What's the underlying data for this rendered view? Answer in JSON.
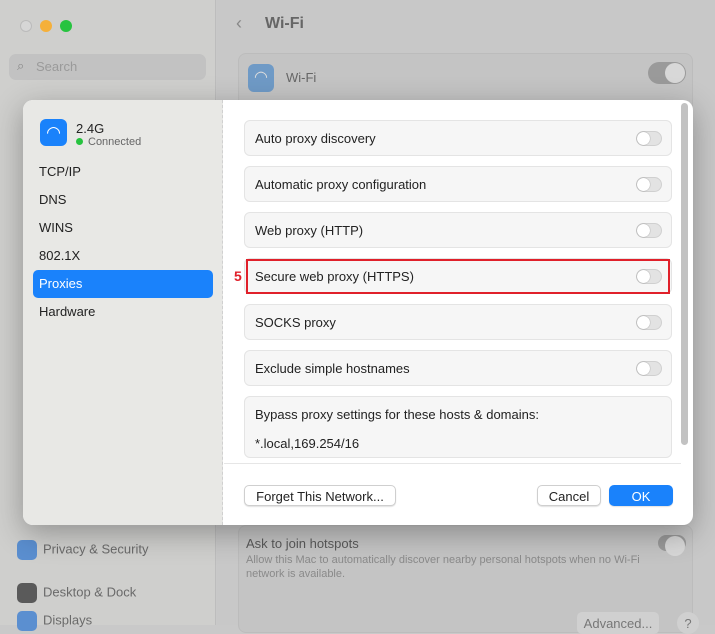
{
  "background": {
    "search_placeholder": "Search",
    "title": "Wi-Fi",
    "wifi_label": "Wi-Fi",
    "sidebar_items": [
      "Privacy & Security",
      "Desktop & Dock",
      "Displays"
    ],
    "hotspots_title": "Ask to join hotspots",
    "hotspots_desc": "Allow this Mac to automatically discover nearby personal hotspots when no Wi-Fi network is available.",
    "advanced_label": "Advanced...",
    "help_label": "?"
  },
  "dialog": {
    "network_name": "2.4G",
    "network_status": "Connected",
    "nav": [
      "TCP/IP",
      "DNS",
      "WINS",
      "802.1X",
      "Proxies",
      "Hardware"
    ],
    "selected_nav": "Proxies",
    "proxies": [
      {
        "label": "Auto proxy discovery",
        "enabled": false
      },
      {
        "label": "Automatic proxy configuration",
        "enabled": false
      },
      {
        "label": "Web proxy (HTTP)",
        "enabled": false
      },
      {
        "label": "Secure web proxy (HTTPS)",
        "enabled": false
      },
      {
        "label": "SOCKS proxy",
        "enabled": false
      },
      {
        "label": "Exclude simple hostnames",
        "enabled": false
      }
    ],
    "bypass_label": "Bypass proxy settings for these hosts & domains:",
    "bypass_value": "*.local,169.254/16",
    "annotation_number": "5",
    "forget_label": "Forget This Network...",
    "cancel_label": "Cancel",
    "ok_label": "OK"
  },
  "colors": {
    "accent": "#1a82fb",
    "highlight": "#e0202a",
    "connected": "#27c33f"
  }
}
